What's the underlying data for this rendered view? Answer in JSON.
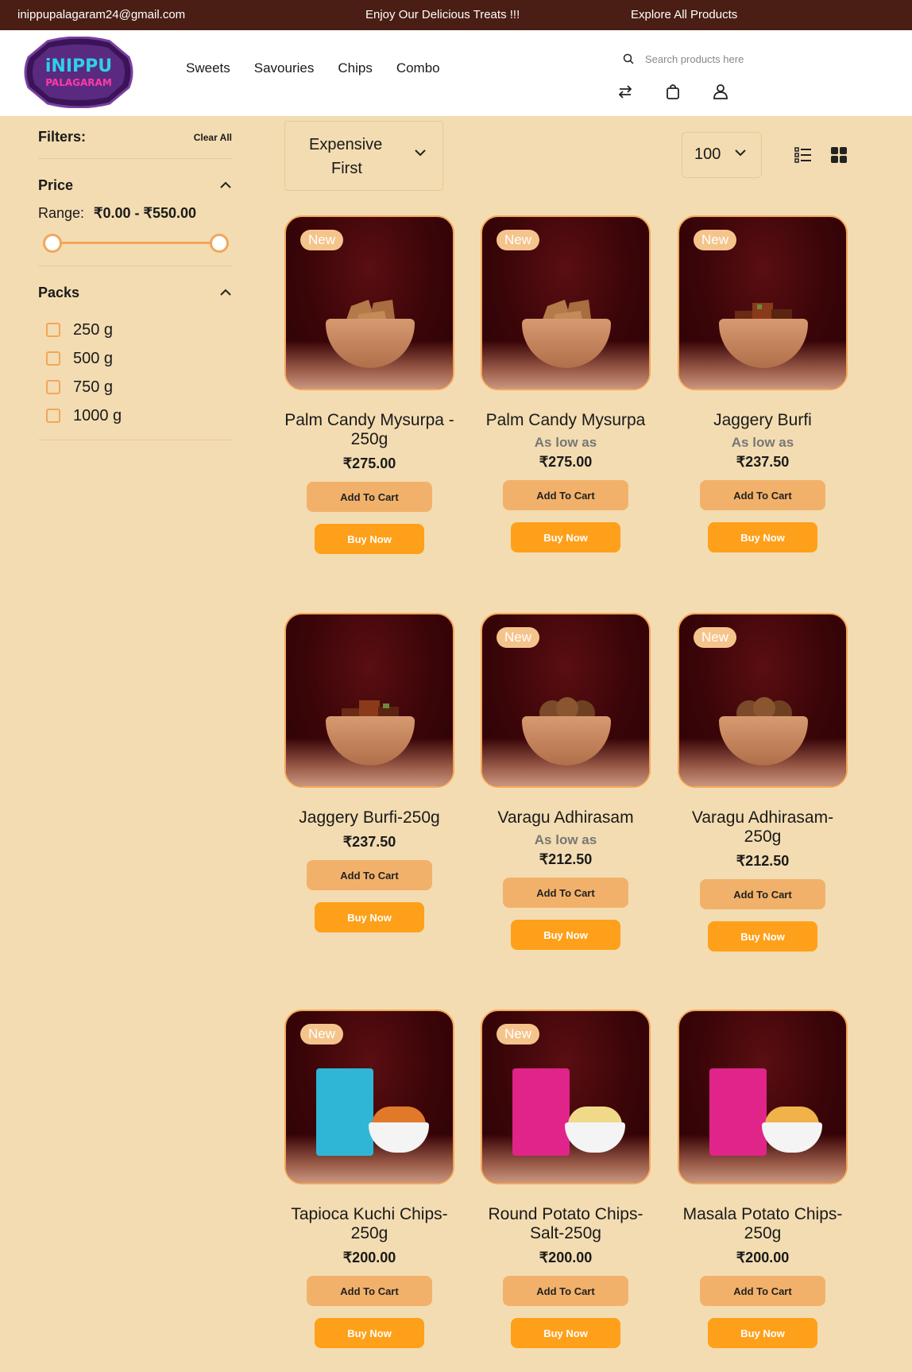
{
  "topbar": {
    "email": "inippupalagaram24@gmail.com",
    "promo": "Enjoy Our Delicious Treats !!!",
    "explore": "Explore All Products"
  },
  "header": {
    "logo_text_top": "iNIPPU",
    "logo_text_bottom": "PALAGARAM",
    "nav": [
      "Sweets",
      "Savouries",
      "Chips",
      "Combo"
    ],
    "search_placeholder": "Search products here",
    "icons": [
      "compare-icon",
      "bag-icon",
      "user-icon"
    ]
  },
  "filters": {
    "title": "Filters:",
    "clear_all": "Clear All",
    "price": {
      "title": "Price",
      "range_label": "Range:",
      "range_value": "₹0.00 - ₹550.00"
    },
    "packs": {
      "title": "Packs",
      "options": [
        "250 g",
        "500 g",
        "750 g",
        "1000 g"
      ]
    }
  },
  "toolbar": {
    "sort_line1": "Expensive",
    "sort_line2": "First",
    "per_page": "100"
  },
  "products": [
    {
      "name": "Palm Candy Mysurpa - 250g",
      "badge": "New",
      "as_low_as": "",
      "price": "₹275.00",
      "cart": "Add To Cart",
      "buy": "Buy Now"
    },
    {
      "name": "Palm Candy Mysurpa",
      "badge": "New",
      "as_low_as": "As low as",
      "price": "₹275.00",
      "cart": "Add To Cart",
      "buy": "Buy Now"
    },
    {
      "name": "Jaggery Burfi",
      "badge": "New",
      "as_low_as": "As low as",
      "price": "₹237.50",
      "cart": "Add To Cart",
      "buy": "Buy Now"
    },
    {
      "name": "Jaggery Burfi-250g",
      "badge": "",
      "as_low_as": "",
      "price": "₹237.50",
      "cart": "Add To Cart",
      "buy": "Buy Now"
    },
    {
      "name": "Varagu Adhirasam",
      "badge": "New",
      "as_low_as": "As low as",
      "price": "₹212.50",
      "cart": "Add To Cart",
      "buy": "Buy Now"
    },
    {
      "name": "Varagu Adhirasam-250g",
      "badge": "New",
      "as_low_as": "",
      "price": "₹212.50",
      "cart": "Add To Cart",
      "buy": "Buy Now"
    },
    {
      "name": "Tapioca Kuchi Chips-250g",
      "badge": "New",
      "as_low_as": "",
      "price": "₹200.00",
      "cart": "Add To Cart",
      "buy": "Buy Now"
    },
    {
      "name": "Round Potato Chips-Salt-250g",
      "badge": "New",
      "as_low_as": "",
      "price": "₹200.00",
      "cart": "Add To Cart",
      "buy": "Buy Now"
    },
    {
      "name": "Masala Potato Chips-250g",
      "badge": "",
      "as_low_as": "",
      "price": "₹200.00",
      "cart": "Add To Cart",
      "buy": "Buy Now"
    }
  ],
  "colors": {
    "topbar": "#4a1e14",
    "background": "#f3dcb1",
    "accent": "#ffa01a",
    "cart_button": "#f2b16a",
    "border": "#f3a65b"
  }
}
